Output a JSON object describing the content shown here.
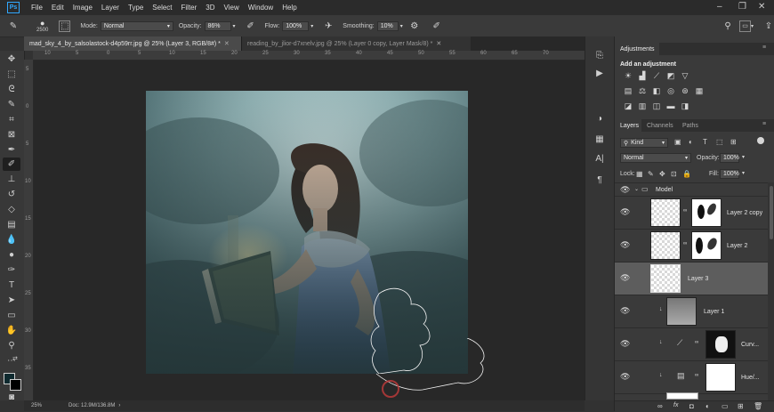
{
  "menu": {
    "app_logo": "Ps",
    "items": [
      "File",
      "Edit",
      "Image",
      "Layer",
      "Type",
      "Select",
      "Filter",
      "3D",
      "View",
      "Window",
      "Help"
    ]
  },
  "options_bar": {
    "brush_size": "2500",
    "mode_label": "Mode:",
    "mode_value": "Normal",
    "opacity_label": "Opacity:",
    "opacity_value": "86%",
    "flow_label": "Flow:",
    "flow_value": "100%",
    "smoothing_label": "Smoothing:",
    "smoothing_value": "10%"
  },
  "tabs": [
    {
      "label": "mad_sky_4_by_salsolastock-d4p59rr.jpg @ 25% (Layer 3, RGB/8#) *",
      "active": true
    },
    {
      "label": "reading_by_jlior-d7xnelv.jpg @ 25% (Layer 0 copy, Layer Mask/8) *",
      "active": false
    }
  ],
  "ruler_top_ticks": [
    "10",
    "5",
    "0",
    "5",
    "10",
    "15",
    "20",
    "25",
    "30",
    "35",
    "40",
    "45",
    "50",
    "55",
    "60",
    "65",
    "70"
  ],
  "ruler_left_ticks": [
    "5",
    "0",
    "5",
    "10",
    "15",
    "20",
    "25",
    "30",
    "35"
  ],
  "status": {
    "zoom": "25%",
    "doc": "Doc: 12.9M/136.8M"
  },
  "adjustments": {
    "tab_label": "Adjustments",
    "subtitle": "Add an adjustment"
  },
  "layers_panel": {
    "tabs": [
      "Layers",
      "Channels",
      "Paths"
    ],
    "kind_label": "Kind",
    "blend_mode": "Normal",
    "opacity_label": "Opacity:",
    "opacity_value": "100%",
    "lock_label": "Lock:",
    "fill_label": "Fill:",
    "fill_value": "100%",
    "group_name": "Model",
    "layers": [
      {
        "name": "Layer 2 copy"
      },
      {
        "name": "Layer 2"
      },
      {
        "name": "Layer 3"
      },
      {
        "name": "Layer 1"
      },
      {
        "name": "Curv..."
      },
      {
        "name": "Hue/..."
      }
    ],
    "footer_icons": [
      "link-icon",
      "fx-icon",
      "mask-icon",
      "adjustment-icon",
      "folder-icon",
      "new-layer-icon",
      "trash-icon"
    ],
    "footer_glyphs": [
      "∞",
      "fx",
      "◘",
      "◐",
      "▭",
      "⊞",
      "🗑"
    ]
  },
  "colors": {
    "canvas_bg": "#282828",
    "panel_bg": "#3a3a3a",
    "selected_layer": "#5d5d5d",
    "accent": "#31a8ff"
  }
}
